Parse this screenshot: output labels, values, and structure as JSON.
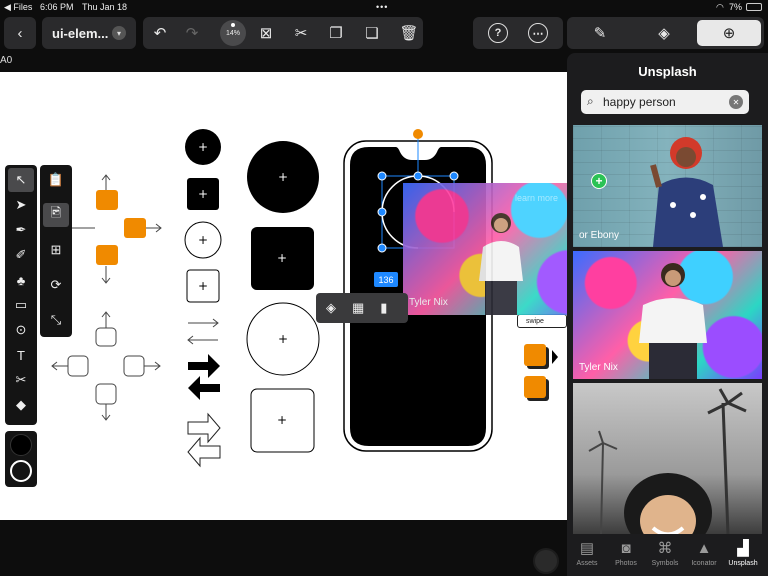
{
  "status": {
    "back_app": "◀ Files",
    "time": "6:06 PM",
    "date": "Thu Jan 18",
    "battery": "7%"
  },
  "header": {
    "doc_name": "ui-elem...",
    "zoom": "14%"
  },
  "canvas": {
    "artboard_label": "A0",
    "dim_badge": "136",
    "swipe_label": "swipe",
    "floating_credit": "Tyler Nix",
    "ghost_text": "learn more"
  },
  "panel": {
    "title": "Unsplash",
    "search_value": "happy person",
    "results": [
      {
        "credit": "or Ebony"
      },
      {
        "credit": "Tyler Nix"
      },
      {
        "credit": ""
      }
    ],
    "tabs": [
      {
        "label": "Assets",
        "icon": "assets-icon"
      },
      {
        "label": "Photos",
        "icon": "camera-icon"
      },
      {
        "label": "Symbols",
        "icon": "command-icon"
      },
      {
        "label": "Iconator",
        "icon": "rocket-icon"
      },
      {
        "label": "Unsplash",
        "icon": "unsplash-icon"
      }
    ]
  },
  "colors": {
    "orange": "#f08a00",
    "blue": "#1e88ff",
    "panel": "#1c1c1e"
  }
}
